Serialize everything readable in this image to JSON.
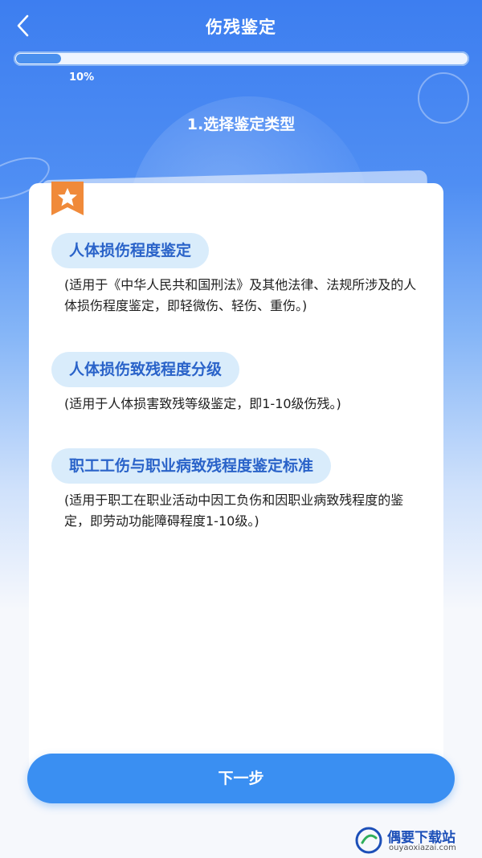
{
  "header": {
    "title": "伤残鉴定"
  },
  "progress": {
    "percent": 10,
    "label": "10%"
  },
  "step": {
    "title": "1.选择鉴定类型"
  },
  "options": [
    {
      "label": "人体损伤程度鉴定",
      "desc": "(适用于《中华人民共和国刑法》及其他法律、法规所涉及的人体损伤程度鉴定，即轻微伤、轻伤、重伤。)"
    },
    {
      "label": "人体损伤致残程度分级",
      "desc": "(适用于人体损害致残等级鉴定，即1-10级伤残。)"
    },
    {
      "label": "职工工伤与职业病致残程度鉴定标准",
      "desc": "(适用于职工在职业活动中因工负伤和因职业病致残程度的鉴定，即劳动功能障碍程度1-10级。)"
    }
  ],
  "footer": {
    "next_label": "下一步"
  },
  "watermark": {
    "name": "偶要下载站",
    "url": "ouyaoxiazai.com"
  },
  "colors": {
    "primary": "#3a8ff2",
    "tag_bg": "#d9ecfb",
    "tag_text": "#2a63c9",
    "badge": "#f08a3a"
  },
  "icons": {
    "back": "chevron-left-icon",
    "badge": "star-bookmark-icon"
  }
}
